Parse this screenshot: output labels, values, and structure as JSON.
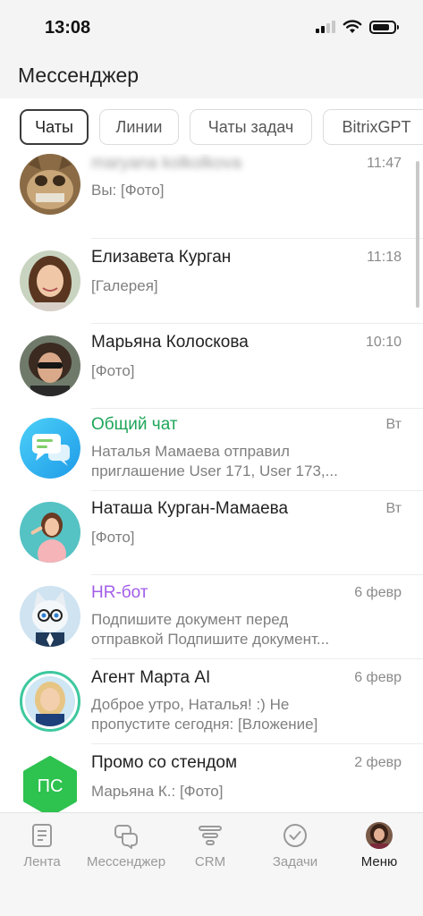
{
  "status_bar": {
    "time": "13:08"
  },
  "header": {
    "title": "Мессенджер"
  },
  "tabs": [
    {
      "label": "Чаты",
      "active": true
    },
    {
      "label": "Линии",
      "active": false
    },
    {
      "label": "Чаты задач",
      "active": false
    },
    {
      "label": "BitrixGPT",
      "active": false
    }
  ],
  "chats": [
    {
      "title": "maryana kolkolkova",
      "time": "11:47",
      "message": "Вы: [Фото]",
      "avatar": "photo-avatar"
    },
    {
      "title": "Елизавета Курган",
      "time": "11:18",
      "message": "[Галерея]",
      "avatar": "photo-avatar"
    },
    {
      "title": "Марьяна Колоскова",
      "time": "10:10",
      "message": "[Фото]",
      "avatar": "photo-avatar"
    },
    {
      "title": "Общий чат",
      "time": "Вт",
      "message_line1": "Наталья Мамаева отправил",
      "message_line2": "приглашение User 171, User 173,...",
      "avatar": "chat-bubbles-icon",
      "title_color": "#1ea65a"
    },
    {
      "title": "Наташа Курган-Мамаева",
      "time": "Вт",
      "message": "[Фото]",
      "avatar": "photo-avatar"
    },
    {
      "title": "HR-бот",
      "time": "6 февр",
      "message_line1": "Подпишите документ перед",
      "message_line2": "отправкой  Подпишите документ...",
      "avatar": "cat-bot-avatar",
      "title_color": "#a35de8"
    },
    {
      "title": "Агент Марта AI",
      "time": "6 февр",
      "message_line1": "Доброе утро, Наталья! :)   Не",
      "message_line2": "пропустите сегодня: [Вложение]",
      "avatar": "photo-avatar"
    },
    {
      "title": "Промо со стендом",
      "time": "2 февр",
      "message": "Марьяна К.: [Фото]",
      "avatar": "initials-avatar",
      "initials": "ПС"
    }
  ],
  "bottom_nav": [
    {
      "label": "Лента",
      "icon": "feed-icon",
      "active": false
    },
    {
      "label": "Мессенджер",
      "icon": "messenger-icon",
      "active": false
    },
    {
      "label": "CRM",
      "icon": "crm-icon",
      "active": false
    },
    {
      "label": "Задачи",
      "icon": "tasks-icon",
      "active": false
    },
    {
      "label": "Меню",
      "icon": "profile-avatar",
      "active": true
    }
  ],
  "colors": {
    "accent_green": "#1ea65a",
    "bot_purple": "#a35de8",
    "header_bg": "#f4f4f5",
    "chat_icon_blue": "#29b6f6"
  }
}
